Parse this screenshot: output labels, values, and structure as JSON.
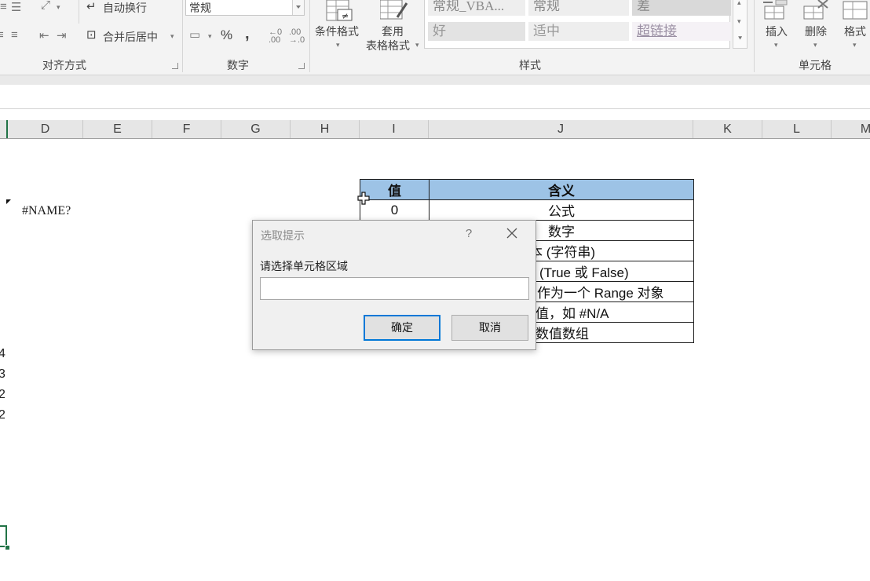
{
  "ribbon": {
    "alignment": {
      "wrap_text": "自动换行",
      "merge_center": "合并后居中",
      "group_label": "对齐方式"
    },
    "number": {
      "format_value": "常规",
      "percent_symbol": "%",
      "comma_symbol": ",",
      "group_label": "数字"
    },
    "styles": {
      "conditional_format": "条件格式",
      "table_format_line1": "套用",
      "table_format_line2": "表格格式",
      "gallery": [
        "常规_VBA...",
        "常规",
        "差",
        "好",
        "适中",
        "超链接"
      ],
      "group_label": "样式"
    },
    "cells": {
      "insert": "插入",
      "delete": "删除",
      "format": "格式",
      "group_label": "单元格"
    }
  },
  "columns": [
    "D",
    "E",
    "F",
    "G",
    "H",
    "I",
    "J",
    "K",
    "L",
    "M"
  ],
  "sheet": {
    "error_cell": "#NAME?",
    "left_edge_digits": [
      "4",
      "3",
      "2",
      "2"
    ]
  },
  "info_table": {
    "headers": [
      "值",
      "含义"
    ],
    "rows": [
      [
        "0",
        "公式"
      ],
      [
        "",
        "数字"
      ],
      [
        "",
        "本 (字符串)"
      ],
      [
        "",
        "(True 或 False)"
      ],
      [
        "",
        "作为一个 Range 对象"
      ],
      [
        "",
        "值，如 #N/A"
      ],
      [
        "",
        "数值数组"
      ]
    ]
  },
  "dialog": {
    "title": "选取提示",
    "help": "?",
    "prompt": "请选择单元格区域",
    "input_value": "",
    "ok": "确定",
    "cancel": "取消"
  },
  "colors": {
    "table_header_fill": "#9dc3e6",
    "dialog_default_border": "#0078d7",
    "bad_style_fill": "#d9d9d9"
  }
}
